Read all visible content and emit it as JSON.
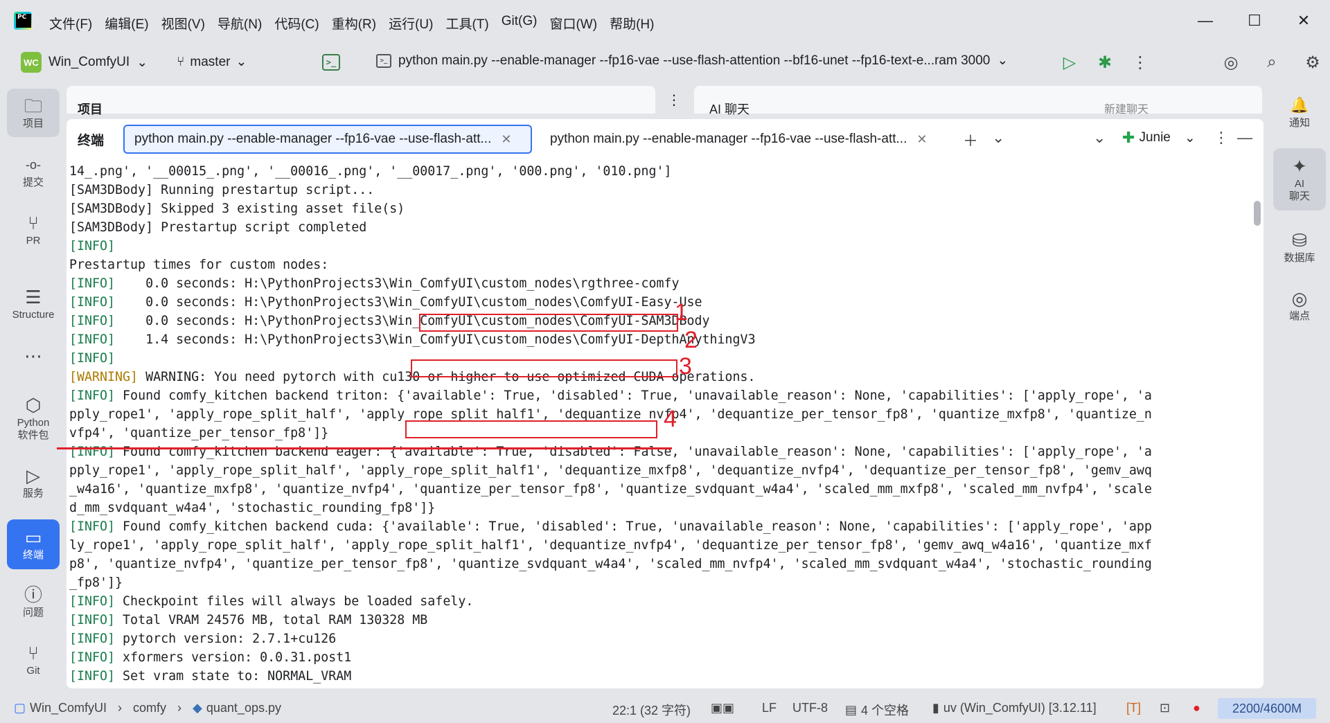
{
  "menu": [
    "文件(F)",
    "编辑(E)",
    "视图(V)",
    "导航(N)",
    "代码(C)",
    "重构(R)",
    "运行(U)",
    "工具(T)",
    "Git(G)",
    "窗口(W)",
    "帮助(H)"
  ],
  "toolbar": {
    "project_badge": "WC",
    "project_name": "Win_ComfyUI",
    "branch": "master",
    "run_config": "python main.py --enable-manager --fp16-vae --use-flash-attention --bf16-unet --fp16-text-e...ram 3000"
  },
  "left_strip": [
    {
      "icon": "folder-icon",
      "glyph": "🗀",
      "label": "项目"
    },
    {
      "icon": "commit-icon",
      "glyph": "-o-",
      "label": "提交"
    },
    {
      "icon": "pull-request-icon",
      "glyph": "⑂",
      "label": "PR"
    },
    {
      "icon": "structure-icon",
      "glyph": "☰",
      "label": "Structure"
    },
    {
      "icon": "more-icon",
      "glyph": "⋯",
      "label": ""
    },
    {
      "icon": "python-packages-icon",
      "glyph": "⬡",
      "label": "Python\n软件包"
    },
    {
      "icon": "services-icon",
      "glyph": "▷",
      "label": "服务"
    },
    {
      "icon": "terminal-icon",
      "glyph": "▭",
      "label": "终端"
    },
    {
      "icon": "problems-icon",
      "glyph": "ⓘ",
      "label": "问题"
    },
    {
      "icon": "git-icon",
      "glyph": "⑂",
      "label": "Git"
    }
  ],
  "right_strip": [
    {
      "icon": "bell-icon",
      "glyph": "🔔",
      "label": "通知"
    },
    {
      "icon": "ai-chat-icon",
      "glyph": "✦",
      "label": "AI\n聊天"
    },
    {
      "icon": "database-icon",
      "glyph": "⛁",
      "label": "数据库"
    },
    {
      "icon": "endpoints-icon",
      "glyph": "◎",
      "label": "端点"
    }
  ],
  "panels": {
    "project_title": "项目",
    "ai_title": "AI 聊天",
    "new_chat": "新建聊天"
  },
  "terminal": {
    "title": "终端",
    "tabs": [
      {
        "label": "python main.py --enable-manager --fp16-vae --use-flash-att..."
      },
      {
        "label": "python main.py --enable-manager --fp16-vae --use-flash-att..."
      }
    ],
    "agent": "Junie",
    "lines": [
      {
        "tag": "",
        "text": "14_.png', '__00015_.png', '__00016_.png', '__00017_.png', '000.png', '010.png']"
      },
      {
        "tag": "",
        "text": "[SAM3DBody] Running prestartup script..."
      },
      {
        "tag": "",
        "text": "[SAM3DBody] Skipped 3 existing asset file(s)"
      },
      {
        "tag": "",
        "text": "[SAM3DBody] Prestartup script completed"
      },
      {
        "tag": "[INFO]",
        "text": ""
      },
      {
        "tag": "",
        "text": "Prestartup times for custom nodes:"
      },
      {
        "tag": "[INFO]",
        "text": "    0.0 seconds: H:\\PythonProjects3\\Win_ComfyUI\\custom_nodes\\rgthree-comfy"
      },
      {
        "tag": "[INFO]",
        "text": "    0.0 seconds: H:\\PythonProjects3\\Win_ComfyUI\\custom_nodes\\ComfyUI-Easy-Use"
      },
      {
        "tag": "[INFO]",
        "text": "    0.0 seconds: H:\\PythonProjects3\\Win_ComfyUI\\custom_nodes\\ComfyUI-SAM3DBody"
      },
      {
        "tag": "[INFO]",
        "text": "    1.4 seconds: H:\\PythonProjects3\\Win_ComfyUI\\custom_nodes\\ComfyUI-DepthAnythingV3"
      },
      {
        "tag": "[INFO]",
        "text": ""
      },
      {
        "tag": "[WARNING]",
        "text": " WARNING: You need pytorch with cu130 or higher to use optimized CUDA operations."
      },
      {
        "tag": "[INFO]",
        "text": " Found comfy_kitchen backend triton: {'available': True, 'disabled': True, 'unavailable_reason': None, 'capabilities': ['apply_rope', 'a"
      },
      {
        "tag": "",
        "text": "pply_rope1', 'apply_rope_split_half', 'apply_rope_split_half1', 'dequantize_nvfp4', 'dequantize_per_tensor_fp8', 'quantize_mxfp8', 'quantize_n"
      },
      {
        "tag": "",
        "text": "vfp4', 'quantize_per_tensor_fp8']}"
      },
      {
        "tag": "[INFO]",
        "text": " Found comfy_kitchen backend eager: {'available': True, 'disabled': False, 'unavailable_reason': None, 'capabilities': ['apply_rope', 'a"
      },
      {
        "tag": "",
        "text": "pply_rope1', 'apply_rope_split_half', 'apply_rope_split_half1', 'dequantize_mxfp8', 'dequantize_nvfp4', 'dequantize_per_tensor_fp8', 'gemv_awq"
      },
      {
        "tag": "",
        "text": "_w4a16', 'quantize_mxfp8', 'quantize_nvfp4', 'quantize_per_tensor_fp8', 'quantize_svdquant_w4a4', 'scaled_mm_mxfp8', 'scaled_mm_nvfp4', 'scale"
      },
      {
        "tag": "",
        "text": "d_mm_svdquant_w4a4', 'stochastic_rounding_fp8']}"
      },
      {
        "tag": "[INFO]",
        "text": " Found comfy_kitchen backend cuda: {'available': True, 'disabled': True, 'unavailable_reason': None, 'capabilities': ['apply_rope', 'app"
      },
      {
        "tag": "",
        "text": "ly_rope1', 'apply_rope_split_half', 'apply_rope_split_half1', 'dequantize_nvfp4', 'dequantize_per_tensor_fp8', 'gemv_awq_w4a16', 'quantize_mxf"
      },
      {
        "tag": "",
        "text": "p8', 'quantize_nvfp4', 'quantize_per_tensor_fp8', 'quantize_svdquant_w4a4', 'scaled_mm_nvfp4', 'scaled_mm_svdquant_w4a4', 'stochastic_rounding"
      },
      {
        "tag": "",
        "text": "_fp8']}"
      },
      {
        "tag": "[INFO]",
        "text": " Checkpoint files will always be loaded safely."
      },
      {
        "tag": "[INFO]",
        "text": " Total VRAM 24576 MB, total RAM 130328 MB"
      },
      {
        "tag": "[INFO]",
        "text": " pytorch version: 2.7.1+cu126"
      },
      {
        "tag": "[INFO]",
        "text": " xformers version: 0.0.31.post1"
      },
      {
        "tag": "[INFO]",
        "text": " Set vram state to: NORMAL_VRAM"
      }
    ]
  },
  "annotations": [
    "1",
    "2",
    "3",
    "4"
  ],
  "statusbar": {
    "project": "Win_ComfyUI",
    "folder": "comfy",
    "file": "quant_ops.py",
    "position": "22:1 (32 字符)",
    "line_sep": "LF",
    "encoding": "UTF-8",
    "indent": "4 个空格",
    "interpreter": "uv (Win_ComfyUI) [3.12.11]",
    "memory": "2200/4600M"
  },
  "colors": {
    "accent": "#3574f0",
    "info": "#1a7c4d",
    "warning": "#ac7b00",
    "annotation": "#e0202a"
  }
}
